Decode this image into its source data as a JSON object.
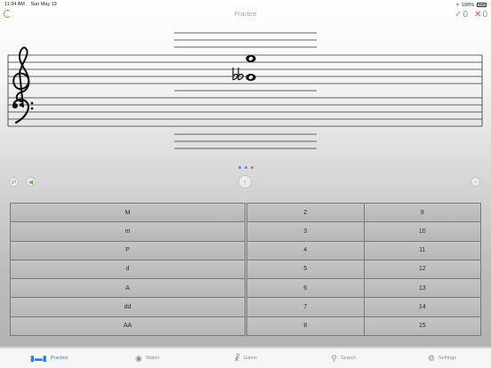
{
  "status_bar": {
    "time": "11:34 AM",
    "date": "Sun May 19",
    "battery": "100%"
  },
  "header": {
    "title": "Practice",
    "correct_count": "0",
    "wrong_count": "0"
  },
  "staff": {
    "clefs": [
      "treble-clef",
      "bass-clef"
    ],
    "accidental": "double-flat",
    "notes": [
      "upper-whole-note",
      "lower-whole-note"
    ]
  },
  "pager": {
    "total": 3,
    "active": 1
  },
  "answer_grid": {
    "qualities": [
      "M",
      "m",
      "P",
      "d",
      "A",
      "dd",
      "AA"
    ],
    "numbers": [
      [
        "2",
        "9"
      ],
      [
        "3",
        "10"
      ],
      [
        "4",
        "11"
      ],
      [
        "5",
        "12"
      ],
      [
        "6",
        "13"
      ],
      [
        "7",
        "14"
      ],
      [
        "8",
        "15"
      ]
    ]
  },
  "tabs": [
    {
      "label": "Practice",
      "icon": "dumbbell-icon",
      "active": true
    },
    {
      "label": "Watch",
      "icon": "eye-icon",
      "active": false
    },
    {
      "label": "Game",
      "icon": "trophy-icon",
      "active": false
    },
    {
      "label": "Search",
      "icon": "search-icon",
      "active": false
    },
    {
      "label": "Settings",
      "icon": "gear-icon",
      "active": false
    }
  ],
  "colors": {
    "accent": "#2e7fe2",
    "correct": "#7cc55a",
    "wrong": "#e0505a"
  }
}
